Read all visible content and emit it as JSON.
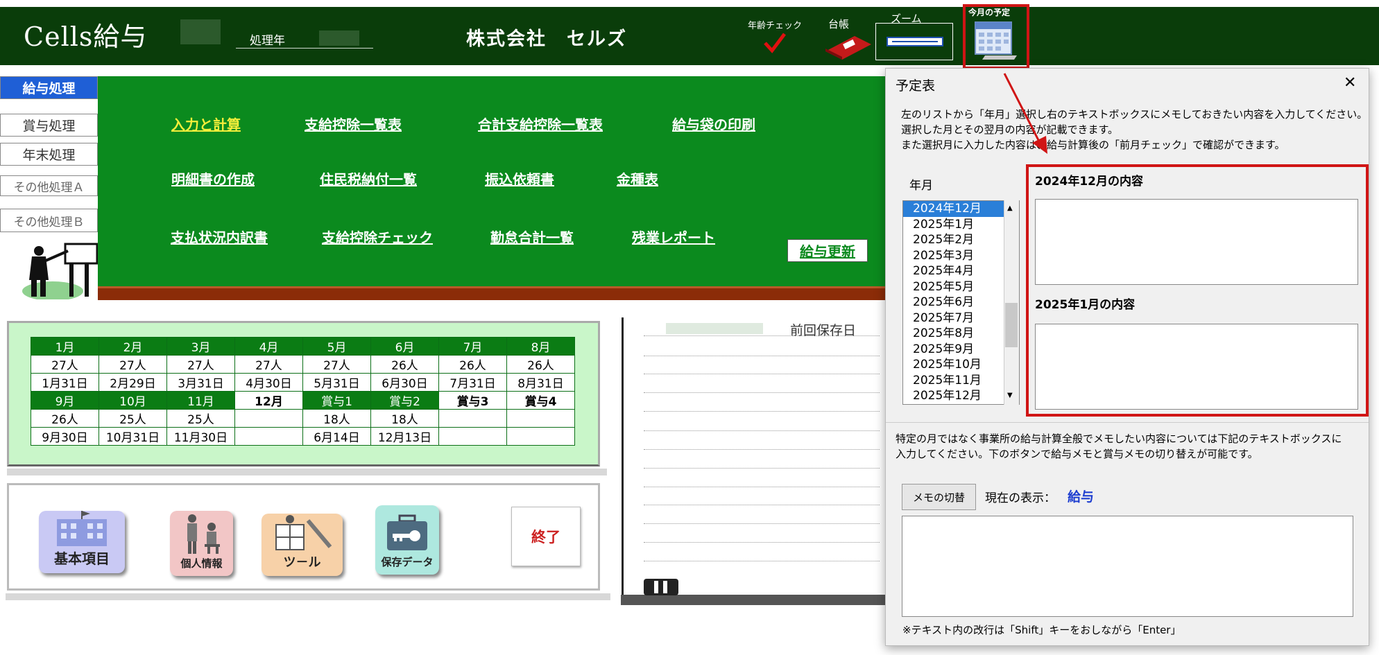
{
  "header": {
    "app_title": "Cells給与",
    "year_label": "処理年",
    "company": "株式会社　セルズ",
    "age_check_label": "年齢チェック",
    "ledger_label": "台帳",
    "zoom_label": "ズーム",
    "schedule_label": "今月の予定"
  },
  "nav": {
    "payroll": "給与処理",
    "bonus": "賞与処理",
    "year_end": "年末処理",
    "other_a": "その他処理Ａ",
    "other_b": "その他処理Ｂ"
  },
  "menu": {
    "row1": [
      "入力と計算",
      "支給控除一覧表",
      "合計支給控除一覧表",
      "給与袋の印刷"
    ],
    "row2": [
      "明細書の作成",
      "住民税納付一覧",
      "振込依頼書",
      "金種表"
    ],
    "row3": [
      "支払状況内訳書",
      "支給控除チェック",
      "勤怠合計一覧",
      "残業レポート"
    ],
    "update": "給与更新"
  },
  "calendar": {
    "row1_headers": [
      "1月",
      "2月",
      "3月",
      "4月",
      "5月",
      "6月",
      "7月",
      "8月"
    ],
    "row1_counts": [
      "27人",
      "27人",
      "27人",
      "27人",
      "27人",
      "26人",
      "26人",
      "26人"
    ],
    "row1_dates": [
      "1月31日",
      "2月29日",
      "3月31日",
      "4月30日",
      "5月31日",
      "6月30日",
      "7月31日",
      "8月31日"
    ],
    "row2_headers": [
      "9月",
      "10月",
      "11月",
      "12月",
      "賞与1",
      "賞与2",
      "賞与3",
      "賞与4"
    ],
    "row2_counts": [
      "26人",
      "25人",
      "25人",
      "",
      "18人",
      "18人",
      "",
      ""
    ],
    "row2_dates": [
      "9月30日",
      "10月31日",
      "11月30日",
      "",
      "6月14日",
      "12月13日",
      "",
      ""
    ]
  },
  "tiles": {
    "basic": "基本項目",
    "personal": "個人情報",
    "tools": "ツ－ル",
    "saved": "保存データ",
    "end": "終了"
  },
  "notepad": {
    "last_saved": "前回保存日"
  },
  "dialog": {
    "title": "予定表",
    "close": "✕",
    "intro": [
      "左のリストから「年月」選択し右のテキストボックスにメモしておきたい内容を入力してください。",
      "選択した月とその翌月の内容が記載できます。",
      "また選択月に入力した内容は、給与計算後の「前月チェック」で確認ができます。"
    ],
    "month_label": "年月",
    "months": [
      "2024年12月",
      "2025年1月",
      "2025年2月",
      "2025年3月",
      "2025年4月",
      "2025年5月",
      "2025年6月",
      "2025年7月",
      "2025年8月",
      "2025年9月",
      "2025年10月",
      "2025年11月",
      "2025年12月"
    ],
    "selected_month": "2024年12月",
    "memo1_title": "2024年12月の内容",
    "memo1_value": "",
    "memo2_title": "2025年1月の内容",
    "memo2_value": "",
    "general_note": [
      "特定の月ではなく事業所の給与計算全般でメモしたい内容については下記のテキストボックスに",
      "入力してください。下のボタンで給与メモと賞与メモの切り替えが可能です。"
    ],
    "memo_switch": "メモの切替",
    "current_display_label": "現在の表示：",
    "current_display_value": "給与",
    "general_memo_value": "",
    "footer_note": "※テキスト内の改行は「Shift」キーをおしながら「Enter」"
  },
  "colors": {
    "header_bg": "#0a3d0a",
    "board_green": "#0b8a1e",
    "highlight_red": "#d01515",
    "list_select_blue": "#2a7fd8"
  }
}
